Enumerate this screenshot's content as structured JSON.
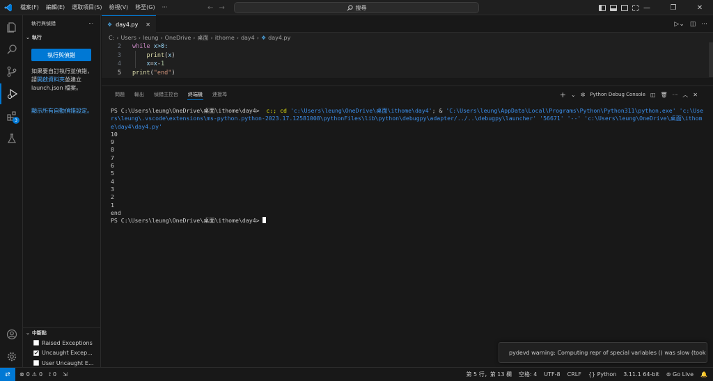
{
  "titlebar": {
    "menu": [
      "檔案(F)",
      "編輯(E)",
      "選取項目(S)",
      "檢視(V)",
      "移至(G)",
      "···"
    ],
    "search_text": "搜尋"
  },
  "activity": {
    "debug_badge": "3"
  },
  "sidebar": {
    "title": "執行與偵錯",
    "more": "···",
    "section_run": "執行",
    "run_button": "執行與偵錯",
    "help_text_1": "如果要自訂執行並偵錯，請",
    "help_link": "開啟資料夾",
    "help_text_2": "並建立 launch.json 檔案。",
    "show_all": "顯示所有自動偵錯設定。",
    "breakpoints": {
      "title": "中斷點",
      "items": [
        {
          "label": "Raised Exceptions",
          "checked": false
        },
        {
          "label": "Uncaught Excep...",
          "checked": true
        },
        {
          "label": "User Uncaught E...",
          "checked": false
        }
      ]
    }
  },
  "editor": {
    "tab_label": "day4.py",
    "breadcrumb": [
      "C:",
      "Users",
      "leung",
      "OneDrive",
      "桌面",
      "ithome",
      "day4",
      "day4.py"
    ],
    "lines": [
      {
        "n": "2"
      },
      {
        "n": "3"
      },
      {
        "n": "4"
      },
      {
        "n": "5"
      }
    ],
    "code": {
      "l2_kw": "while",
      "l2_rest": "x>0:",
      "l3_fn": "print",
      "l3_arg": "x",
      "l4_a": "x",
      "l4_b": "x",
      "l4_num": "1",
      "l5_fn": "print",
      "l5_str": "\"end\""
    }
  },
  "panel": {
    "tabs": [
      "問題",
      "輸出",
      "偵錯主控台",
      "終端機",
      "連接埠"
    ],
    "active_tab": "終端機",
    "debug_console_label": "Python Debug Console",
    "prompt": "PS C:\\Users\\leung\\OneDrive\\桌面\\ithome\\day4>",
    "cmd_head": "c:; cd",
    "cmd_path": "'c:\\Users\\leung\\OneDrive\\桌面\\ithome\\day4'",
    "cmd_amp": "; &",
    "cmd_exe": "'C:\\Users\\leung\\AppData\\Local\\Programs\\Python\\Python311\\python.exe'",
    "cmd_launcher": "'c:\\Users\\leung\\.vscode\\extensions\\ms-python.python-2023.17.12581008\\pythonFiles\\lib\\python\\debugpy\\adapter/../..\\debugpy\\launcher'",
    "cmd_port": "'56671'",
    "cmd_dash": "'--'",
    "cmd_file": "'c:\\Users\\leung\\OneDrive\\桌面\\ithome\\day4\\day4.py'",
    "output": [
      "10",
      "9",
      "8",
      "7",
      "6",
      "5",
      "4",
      "3",
      "2",
      "1",
      "end"
    ]
  },
  "notification": {
    "text": "pydevd warning: Computing repr of special variables () was slow (took ..."
  },
  "statusbar": {
    "errors": "0",
    "warnings": "0",
    "ports": "0",
    "position": "第 5 行，第 13 欄",
    "spaces": "空格: 4",
    "encoding": "UTF-8",
    "eol": "CRLF",
    "language": "Python",
    "interpreter": "3.11.1 64-bit",
    "golive": "Go Live"
  },
  "colors": {
    "accent": "#0078d4",
    "background": "#181818",
    "editor_bg": "#1f1f1f"
  }
}
